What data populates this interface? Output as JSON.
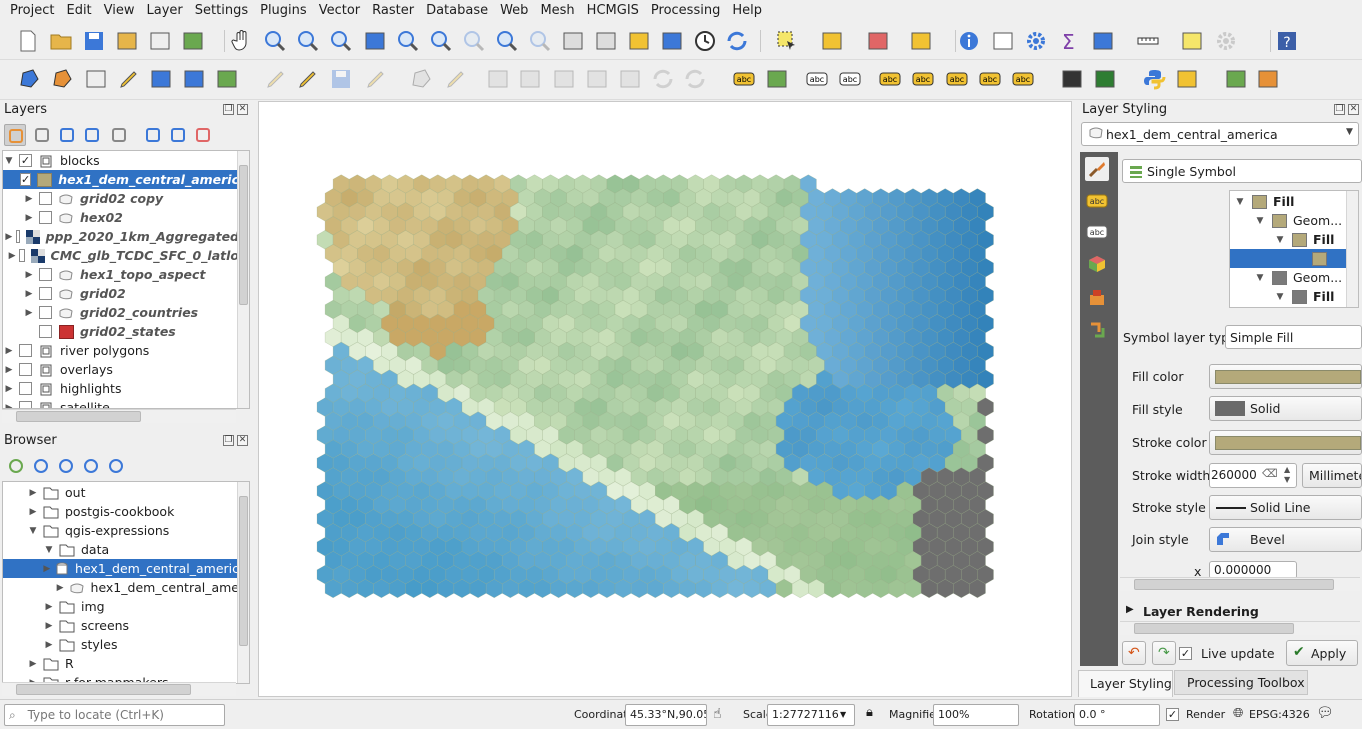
{
  "menu": [
    "Project",
    "Edit",
    "View",
    "Layer",
    "Settings",
    "Plugins",
    "Vector",
    "Raster",
    "Database",
    "Web",
    "Mesh",
    "HCMGIS",
    "Processing",
    "Help"
  ],
  "layers_panel": {
    "title": "Layers",
    "items": [
      {
        "label": "blocks",
        "checked": true,
        "expanded": true,
        "kind": "group"
      },
      {
        "label": "hex1_dem_central_americ",
        "checked": true,
        "kind": "polygon-fill",
        "selected": true
      },
      {
        "label": "grid02 copy",
        "checked": false,
        "kind": "polygon"
      },
      {
        "label": "hex02",
        "checked": false,
        "kind": "polygon"
      },
      {
        "label": "ppp_2020_1km_Aggregated",
        "checked": false,
        "kind": "raster"
      },
      {
        "label": "CMC_glb_TCDC_SFC_0_latlo",
        "checked": false,
        "kind": "raster"
      },
      {
        "label": "hex1_topo_aspect",
        "checked": false,
        "kind": "polygon"
      },
      {
        "label": "grid02",
        "checked": false,
        "kind": "polygon"
      },
      {
        "label": "grid02_countries",
        "checked": false,
        "kind": "polygon"
      },
      {
        "label": "grid02_states",
        "checked": false,
        "kind": "polygon-red"
      },
      {
        "label": "river polygons",
        "checked": false,
        "kind": "group"
      },
      {
        "label": "overlays",
        "checked": false,
        "kind": "group"
      },
      {
        "label": "highlights",
        "checked": false,
        "kind": "group"
      },
      {
        "label": "satellite",
        "checked": false,
        "kind": "group"
      }
    ]
  },
  "browser_panel": {
    "title": "Browser",
    "items": [
      {
        "label": "out",
        "kind": "folder"
      },
      {
        "label": "postgis-cookbook",
        "kind": "folder"
      },
      {
        "label": "qgis-expressions",
        "kind": "folder",
        "expanded": true
      },
      {
        "label": "data",
        "kind": "folder",
        "expanded": true
      },
      {
        "label": "hex1_dem_central_americ",
        "kind": "database",
        "selected": true
      },
      {
        "label": "hex1_dem_central_ame",
        "kind": "polygon"
      },
      {
        "label": "img",
        "kind": "folder"
      },
      {
        "label": "screens",
        "kind": "folder"
      },
      {
        "label": "styles",
        "kind": "folder"
      },
      {
        "label": "R",
        "kind": "folder"
      },
      {
        "label": "r-for-mapmakers",
        "kind": "folder"
      }
    ]
  },
  "styling": {
    "title": "Layer Styling",
    "layer_select": "hex1_dem_central_america",
    "renderer": "Single Symbol",
    "symbol_tree": [
      {
        "label": "Fill",
        "bold": true
      },
      {
        "label": "Geom..."
      },
      {
        "label": "Fill",
        "bold": true
      },
      {
        "label": "",
        "selected": true
      },
      {
        "label": "Geom..."
      },
      {
        "label": "Fill",
        "bold": true
      }
    ],
    "symbol_layer_type_label": "Symbol layer type",
    "symbol_layer_type": "Simple Fill",
    "fill_color_label": "Fill color",
    "fill_style_label": "Fill style",
    "fill_style": "Solid",
    "stroke_color_label": "Stroke color",
    "stroke_width_label": "Stroke width",
    "stroke_width": "260000",
    "stroke_unit": "Millimete",
    "stroke_style_label": "Stroke style",
    "stroke_style": "Solid Line",
    "join_style_label": "Join style",
    "join_style": "Bevel",
    "offset_x_label": "x",
    "offset_x": "0.000000",
    "layer_rendering": "Layer Rendering",
    "live_update": "Live update",
    "apply": "Apply",
    "tab_styling": "Layer Styling",
    "tab_toolbox": "Processing Toolbox",
    "colors": {
      "fill": "#b4a97a",
      "stroke": "#b4a97a",
      "fill_style_swatch": "#6a6a6a"
    }
  },
  "status": {
    "locate_placeholder": "Type to locate (Ctrl+K)",
    "coordinate_label": "Coordinate",
    "coordinate": "45.33°N,90.05°W",
    "scale_label": "Scale",
    "scale": "1:27727116",
    "magnifier_label": "Magnifier",
    "magnifier": "100%",
    "rotation_label": "Rotation",
    "rotation": "0.0 °",
    "render_label": "Render",
    "crs": "EPSG:4326"
  },
  "colors": {
    "selection": "#3072c4",
    "land_hex": "#a8c89a",
    "ocean": "#5aa8cf",
    "deep_ocean": "#2e7fb8",
    "nodata": "#6e6e6e",
    "highland": "#c4a867"
  }
}
